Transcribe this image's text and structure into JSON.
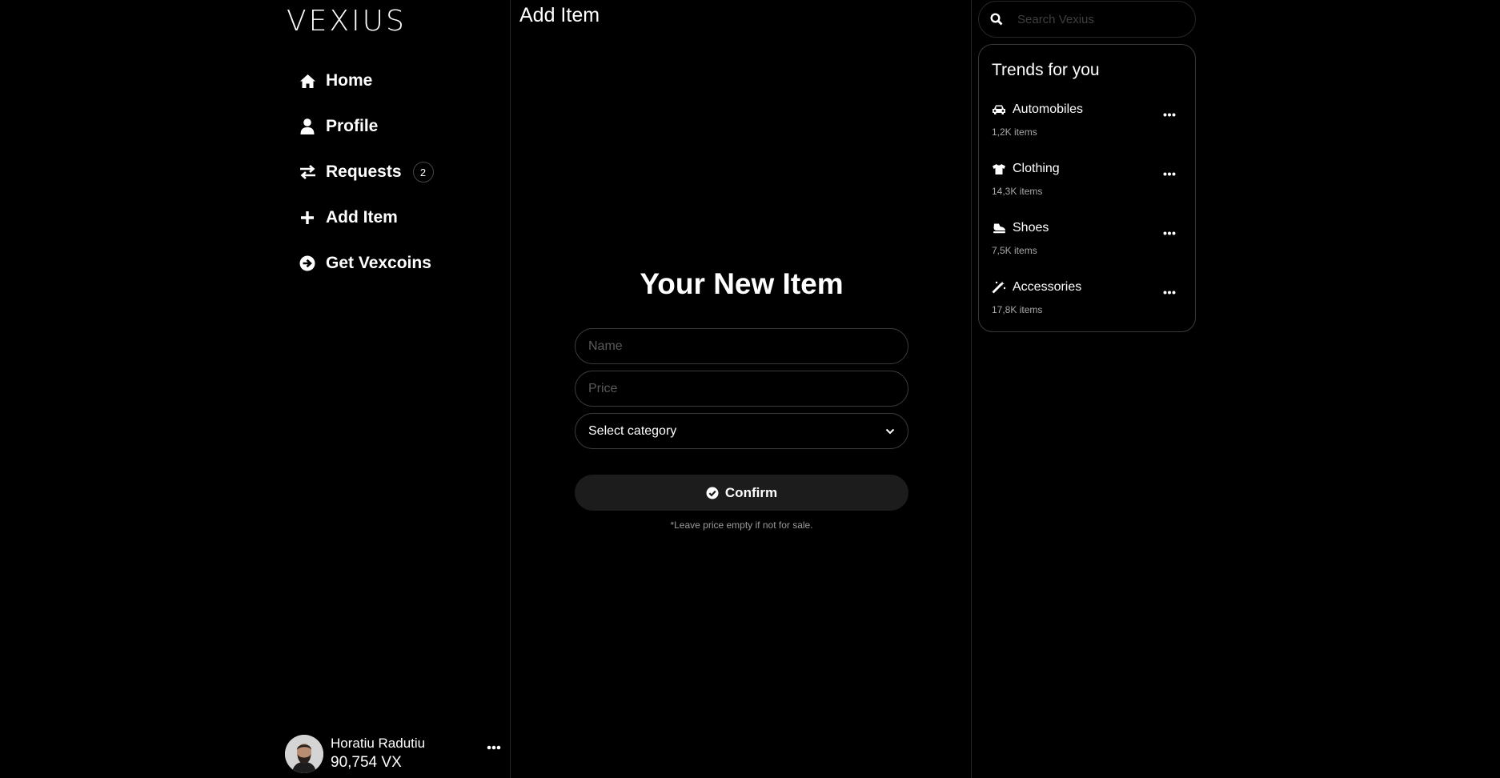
{
  "app": {
    "logo": "VEXIUS"
  },
  "sidebar": {
    "items": [
      {
        "label": "Home",
        "icon": "home-icon"
      },
      {
        "label": "Profile",
        "icon": "user-icon"
      },
      {
        "label": "Requests",
        "icon": "exchange-icon",
        "badge": "2"
      },
      {
        "label": "Add Item",
        "icon": "plus-icon"
      },
      {
        "label": "Get Vexcoins",
        "icon": "arrow-circle-right-icon"
      }
    ],
    "user": {
      "name": "Horatiu Radutiu",
      "balance": "90,754 VX"
    }
  },
  "main": {
    "title": "Add Item",
    "form": {
      "heading": "Your New Item",
      "name_placeholder": "Name",
      "price_placeholder": "Price",
      "category_value": "Select category",
      "confirm_label": "Confirm",
      "note": "*Leave price empty if not for sale."
    }
  },
  "right": {
    "search_placeholder": "Search Vexius",
    "trends_title": "Trends for you",
    "trends": [
      {
        "name": "Automobiles",
        "count": "1,2K items",
        "icon": "car-icon"
      },
      {
        "name": "Clothing",
        "count": "14,3K items",
        "icon": "tshirt-icon"
      },
      {
        "name": "Shoes",
        "count": "7,5K items",
        "icon": "shoe-icon"
      },
      {
        "name": "Accessories",
        "count": "17,8K items",
        "icon": "magic-wand-icon"
      }
    ]
  },
  "colors": {
    "background": "#000000",
    "border": "#262626",
    "button": "#1c1c1c",
    "text": "#ffffff"
  }
}
